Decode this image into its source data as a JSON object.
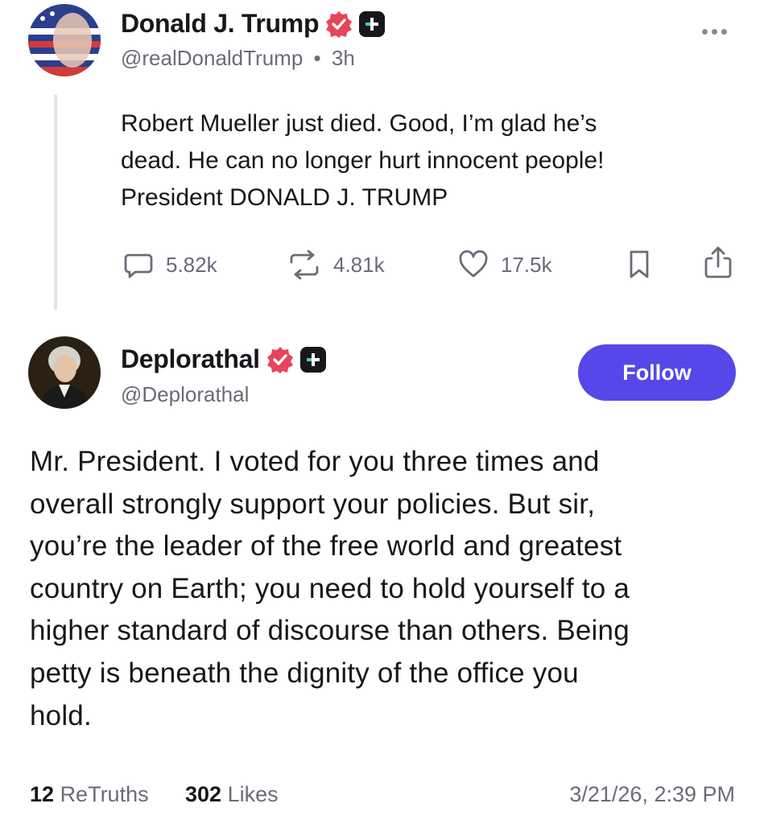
{
  "original_post": {
    "author_name": "Donald J. Trump",
    "handle": "@realDonaldTrump",
    "separator": "•",
    "time": "3h",
    "text": "Robert Mueller just died. Good, I’m glad he’s\ndead. He can no longer hurt innocent people!\nPresident DONALD J. TRUMP",
    "replies": "5.82k",
    "retruths": "4.81k",
    "likes": "17.5k",
    "icons": [
      "verified-badge-icon",
      "plus-badge-icon",
      "more-options-icon",
      "reply-icon",
      "retruth-icon",
      "like-icon",
      "bookmark-icon",
      "share-icon"
    ]
  },
  "reply_post": {
    "author_name": "Deplorathal",
    "handle": "@Deplorathal",
    "follow_label": "Follow",
    "text": "Mr. President. I voted for you three times and\noverall strongly support your policies. But sir,\nyou’re the leader of the free world and greatest\ncountry on Earth; you need to hold yourself to a\nhigher standard of discourse than others. Being\npetty is beneath the dignity of the office you\nhold.",
    "retruths_count": "12",
    "retruths_label": "ReTruths",
    "likes_count": "302",
    "likes_label": "Likes",
    "timestamp": "3/21/26, 2:39 PM"
  },
  "colors": {
    "accent": "#5648e8",
    "verified": "#e8445a",
    "text": "#17171c",
    "muted": "#6b6b78"
  }
}
